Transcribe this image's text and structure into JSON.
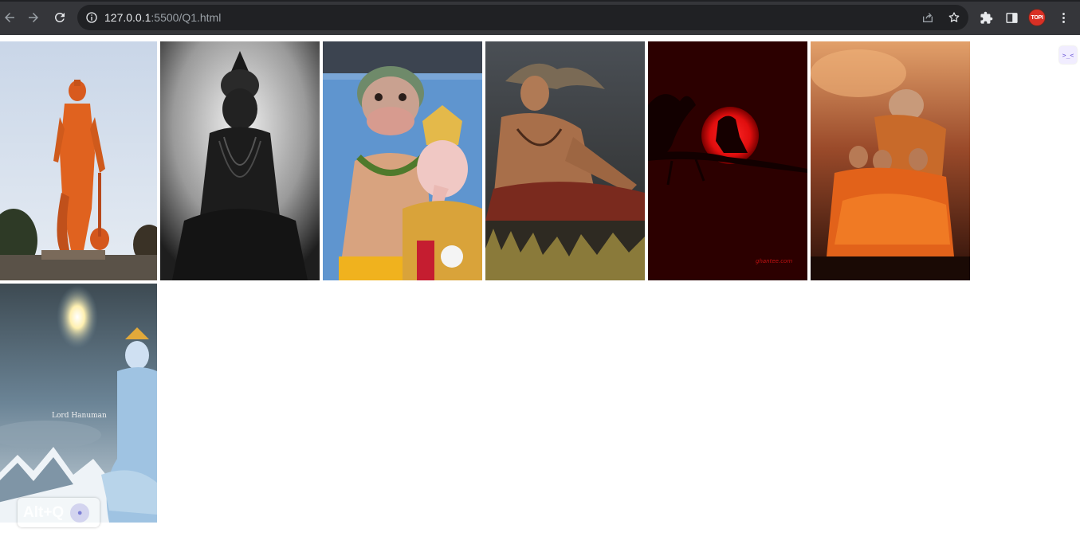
{
  "browser": {
    "url_host": "127.0.0.1",
    "url_rest": ":5500/Q1.html",
    "profile_initials": "TOPI"
  },
  "icons": {
    "back": "arrow-left-icon",
    "forward": "arrow-right-icon",
    "reload": "reload-icon",
    "info": "info-icon",
    "share": "share-icon",
    "bookmark": "star-icon",
    "extensions": "puzzle-icon",
    "side_panel": "side-panel-icon",
    "menu": "kebab-menu-icon"
  },
  "gallery": {
    "images": [
      {
        "subject": "orange-statue"
      },
      {
        "subject": "black-statue"
      },
      {
        "subject": "idols"
      },
      {
        "subject": "meditating-painting"
      },
      {
        "subject": "red-moon-silhouette",
        "watermark": "ghantee.com"
      },
      {
        "subject": "group-painting"
      },
      {
        "subject": "sky-painting",
        "caption": "Lord Hanuman"
      }
    ]
  },
  "side_widget": {
    "label": ">_<"
  },
  "overlay": {
    "shortcut_label": "Alt+Q",
    "mic_icon": "mic-icon"
  },
  "colors": {
    "toolbar": "#35363a",
    "omnibox": "#202124",
    "avatar": "#d93025"
  }
}
